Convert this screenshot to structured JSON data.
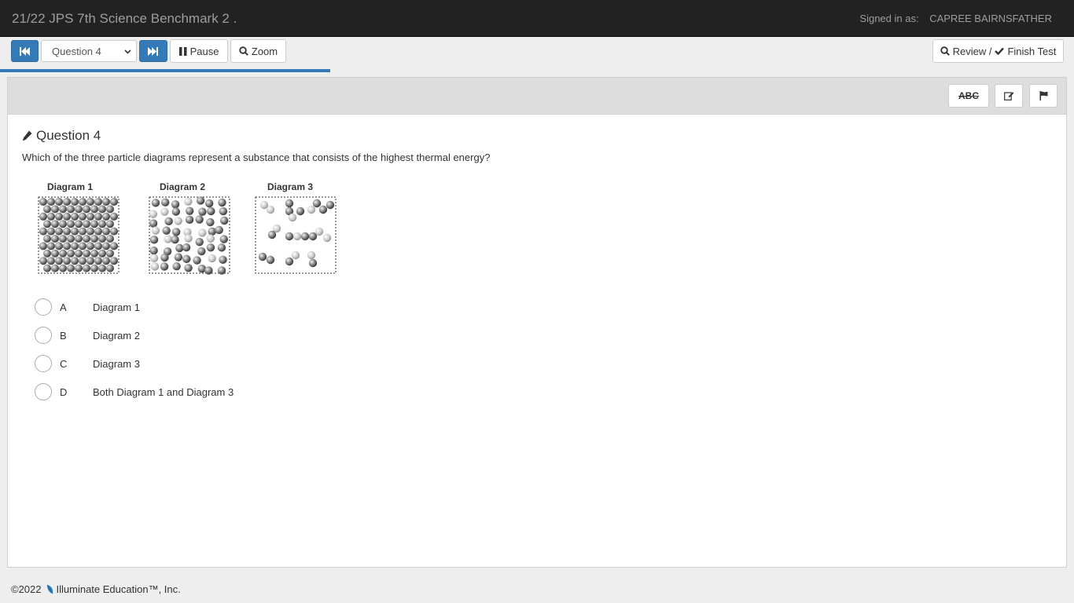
{
  "header": {
    "title": "21/22 JPS 7th Science Benchmark 2 .",
    "signed_in_label": "Signed in as:",
    "user_name": "CAPREE BAIRNSFATHER"
  },
  "toolbar": {
    "question_select_value": "Question 4",
    "pause_label": "Pause",
    "zoom_label": "Zoom",
    "review_label": "Review /",
    "finish_label": "Finish Test",
    "progress_fraction": 0.31
  },
  "question_tools": {
    "strikethrough_label": "ABC",
    "notes_icon": "edit-icon",
    "flag_icon": "flag-icon"
  },
  "question": {
    "title": "Question 4",
    "text": "Which of the three particle diagrams represent a substance that consists of the highest thermal energy?",
    "diagram_labels": [
      "Diagram 1",
      "Diagram 2",
      "Diagram 3"
    ],
    "choices": [
      {
        "letter": "A",
        "text": "Diagram 1"
      },
      {
        "letter": "B",
        "text": "Diagram 2"
      },
      {
        "letter": "C",
        "text": "Diagram 3"
      },
      {
        "letter": "D",
        "text": "Both Diagram 1 and Diagram 3"
      }
    ]
  },
  "footer": {
    "copyright": "©2022",
    "company": "Illuminate Education™, Inc."
  },
  "colors": {
    "primary": "#337ab7",
    "navbar": "#222222",
    "page_bg": "#eeeeee"
  }
}
